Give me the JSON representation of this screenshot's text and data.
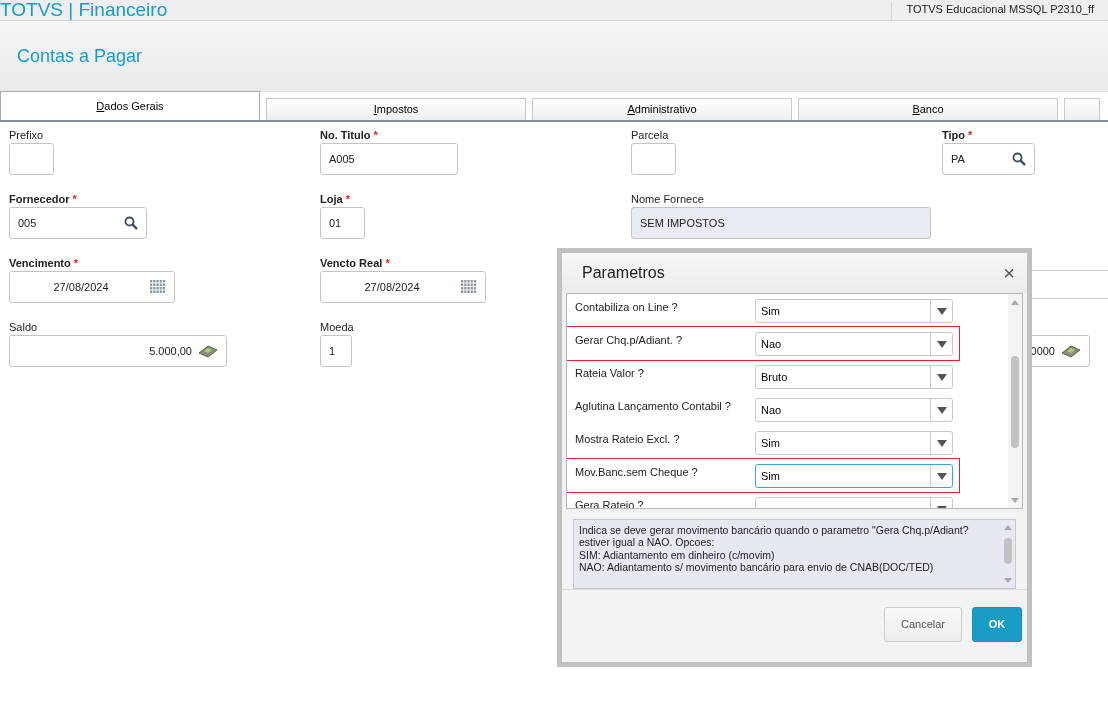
{
  "app": {
    "title": "TOTVS | Financeiro",
    "environment": "TOTVS Educacional MSSQL P2310_ff"
  },
  "page_title": "Contas a Pagar",
  "tabs": [
    {
      "label": "Dados Gerais",
      "selected": true
    },
    {
      "label": "Impostos",
      "selected": false
    },
    {
      "label": "Administrativo",
      "selected": false
    },
    {
      "label": "Banco",
      "selected": false
    }
  ],
  "form_rows": [
    [
      {
        "label": "Prefixo",
        "kind": "text"
      },
      {
        "label": "No. Titulo",
        "required_mark": "*",
        "kind": "text",
        "value": "A005"
      },
      {
        "label": "Parcela",
        "kind": "text"
      },
      {
        "label": "Tipo",
        "required_mark": "*",
        "kind": "lookup",
        "value": "PA"
      }
    ],
    [
      {
        "label": "Fornecedor",
        "required_mark": "*",
        "kind": "lookup",
        "value": "005"
      },
      {
        "label": "Loja",
        "required_mark": "*",
        "kind": "text",
        "value": "01"
      },
      {
        "label": "Nome Fornece",
        "kind": "readonly",
        "value": "SEM IMPOSTOS"
      }
    ],
    [
      {
        "label": "Vencimento",
        "required_mark": "*",
        "kind": "date",
        "value": "27/08/2024"
      },
      {
        "label": "Vencto Real",
        "required_mark": "*",
        "kind": "date",
        "value": "27/08/2024"
      }
    ],
    [
      {
        "label": "Saldo",
        "kind": "money",
        "value": "5.000,00"
      },
      {
        "label": "Moeda",
        "kind": "number",
        "value": "1"
      },
      {
        "kind": "hidden"
      },
      {
        "kind": "money",
        "value": "0000"
      }
    ]
  ],
  "dialog": {
    "title": "Parametros",
    "close": "×",
    "params": [
      {
        "label": "Contabiliza on Line ?",
        "value": "Sim",
        "highlighted": false,
        "focused": false
      },
      {
        "label": "Gerar Chq.p/Adiant. ?",
        "value": "Nao",
        "highlighted": true,
        "focused": false
      },
      {
        "label": "Rateia Valor ?",
        "value": "Bruto",
        "highlighted": false,
        "focused": false
      },
      {
        "label": "Aglutina Lançamento Contabil ?",
        "value": "Nao",
        "highlighted": false,
        "focused": false
      },
      {
        "label": "Mostra Rateio Excl. ?",
        "value": "Sim",
        "highlighted": false,
        "focused": false
      },
      {
        "label": "Mov.Banc.sem Cheque ?",
        "value": "Sim",
        "highlighted": true,
        "focused": true
      },
      {
        "label": "Gera Rateio ?",
        "highlighted": false,
        "focused": false
      }
    ],
    "help_text": [
      "Indica se deve gerar movimento bancário quando o parametro \"Gera Chq.p/Adiant?",
      "estiver igual a NAO. Opcoes:",
      "SIM: Adiantamento em dinheiro (c/movim)",
      "NAO: Adiantamento s/ movimento bancário para envio de CNAB(DOC/TED)"
    ],
    "buttons": [
      {
        "label": "Cancelar",
        "kind": "secondary"
      },
      {
        "label": "OK",
        "kind": "primary"
      }
    ]
  }
}
